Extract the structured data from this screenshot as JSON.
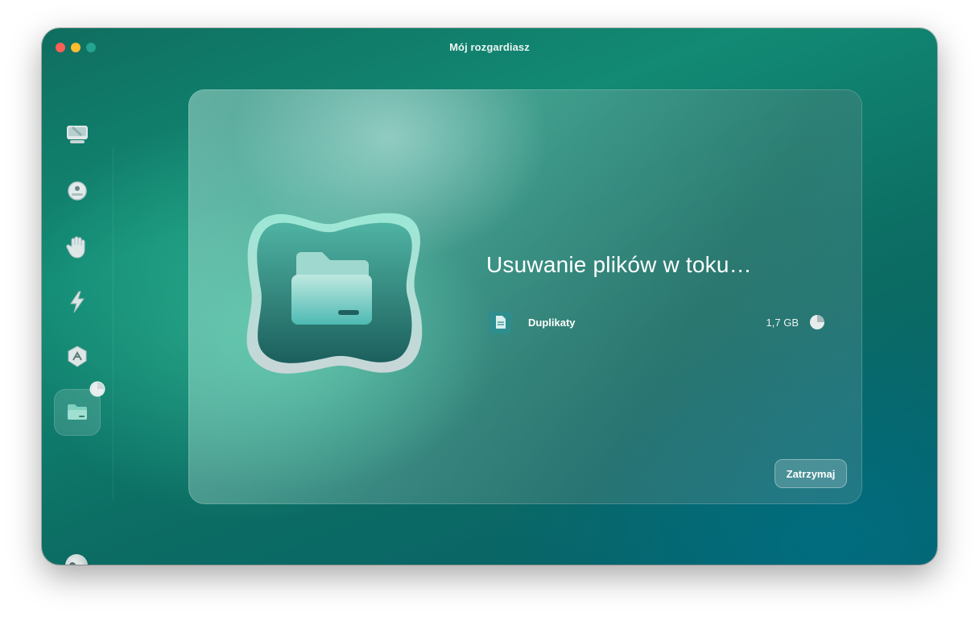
{
  "window": {
    "title": "Mój rozgardiasz"
  },
  "sidebar": {
    "items": [
      {
        "icon": "smart-scan-monitor-icon"
      },
      {
        "icon": "protection-shield-icon"
      },
      {
        "icon": "privacy-hand-icon"
      },
      {
        "icon": "speed-lightning-icon"
      },
      {
        "icon": "applications-icon"
      },
      {
        "icon": "my-clutter-folder-icon",
        "active": true,
        "progress": 0.25
      }
    ],
    "assistant_icon": "assistant-icon"
  },
  "main": {
    "heading": "Usuwanie plików w toku…",
    "item": {
      "label": "Duplikaty",
      "size": "1,7 GB",
      "progress": 0.25
    },
    "stop_label": "Zatrzymaj"
  }
}
